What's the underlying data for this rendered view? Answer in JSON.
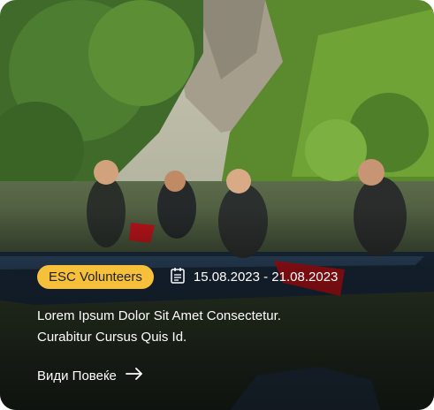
{
  "card": {
    "tag": "ESC Volunteers",
    "date_range": "15.08.2023 - 21.08.2023",
    "description_lines": [
      "Lorem Ipsum Dolor Sit Amet Consectetur.",
      "Curabitur Cursus Quis Id."
    ],
    "more_label": "Види Повеќе",
    "icons": {
      "date": "calendar-icon",
      "more": "arrow-right-icon"
    },
    "colors": {
      "tag_background": "#f7c03a",
      "text": "#ffffff"
    }
  }
}
